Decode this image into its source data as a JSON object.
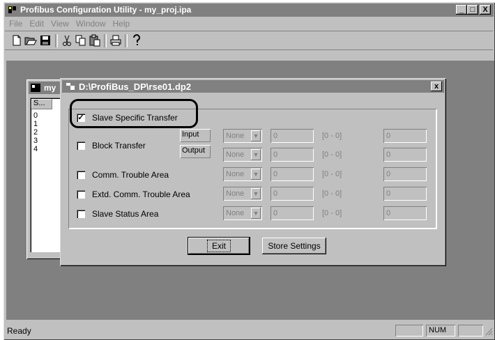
{
  "app": {
    "title": "Profibus Configuration Utility - my_proj.ipa",
    "min_label": "_",
    "max_label": "□",
    "close_label": "X"
  },
  "menu": [
    "File",
    "Edit",
    "View",
    "Window",
    "Help"
  ],
  "toolbar": [
    "new-file-icon",
    "open-folder-icon",
    "save-icon",
    "cut-icon",
    "copy-icon",
    "paste-icon",
    "print-icon",
    "help-icon"
  ],
  "child_window": {
    "title": "my",
    "list_header": "S...",
    "rows": [
      "0",
      "1",
      "2",
      "3",
      "4"
    ]
  },
  "dialog": {
    "title": "D:\\ProfiBus_DP\\rse01.dp2",
    "close_label": "x",
    "slave_specific": {
      "label": "Slave Specific Transfer",
      "checked": true,
      "mark": "✓"
    },
    "input_label": "Input",
    "output_label": "Output",
    "rows": [
      {
        "label": "Block Transfer",
        "combo": "None",
        "value": "0",
        "range": "[0 - 0]",
        "extra": "0"
      },
      {
        "label": "",
        "combo": "None",
        "value": "0",
        "range": "[0 - 0]",
        "extra": "0"
      },
      {
        "label": "Comm. Trouble Area",
        "combo": "None",
        "value": "0",
        "range": "[0 - 0]",
        "extra": "0"
      },
      {
        "label": "Extd. Comm. Trouble Area",
        "combo": "None",
        "value": "0",
        "range": "[0 - 0]",
        "extra": "0"
      },
      {
        "label": "Slave Status Area",
        "combo": "None",
        "value": "0",
        "range": "[0 - 0]",
        "extra": "0"
      }
    ],
    "exit_label": "Exit",
    "store_label": "Store Settings"
  },
  "status": {
    "text": "Ready",
    "num": "NUM"
  }
}
